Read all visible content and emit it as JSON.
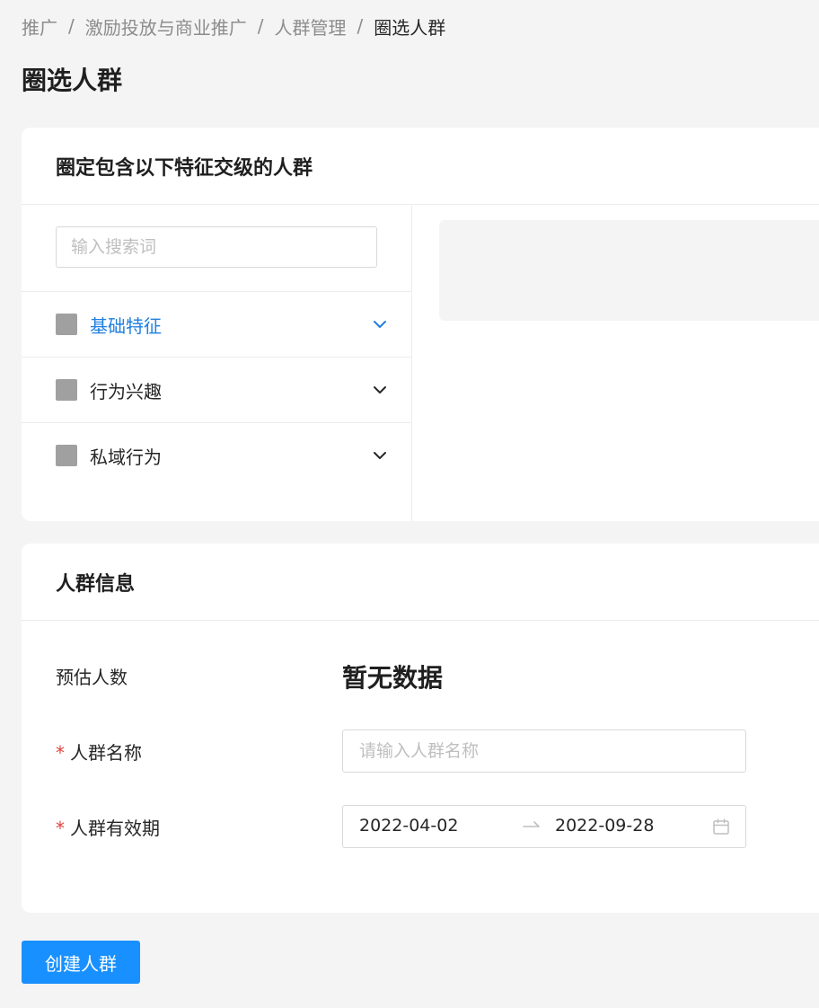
{
  "breadcrumb": [
    "推广",
    "激励投放与商业推广",
    "人群管理",
    "圈选人群"
  ],
  "page_title": "圈选人群",
  "feature_card": {
    "title": "圈定包含以下特征交级的人群",
    "search_placeholder": "输入搜索词",
    "categories": [
      {
        "label": "基础特征",
        "active": true,
        "icon": "chevron-down-icon"
      },
      {
        "label": "行为兴趣",
        "active": false,
        "icon": "chevron-down-icon"
      },
      {
        "label": "私域行为",
        "active": false,
        "icon": "chevron-down-icon"
      }
    ]
  },
  "info_card": {
    "title": "人群信息",
    "estimate_label": "预估人数",
    "estimate_value": "暂无数据",
    "name_label": "人群名称",
    "name_placeholder": "请输入人群名称",
    "validity_label": "人群有效期",
    "date_start": "2022-04-02",
    "date_end": "2022-09-28",
    "required_mark": "*"
  },
  "create_button": "创建人群",
  "colors": {
    "accent": "#1890ff",
    "active_text": "#1f7fe0",
    "required": "#e0423c",
    "background": "#f4f4f4"
  }
}
